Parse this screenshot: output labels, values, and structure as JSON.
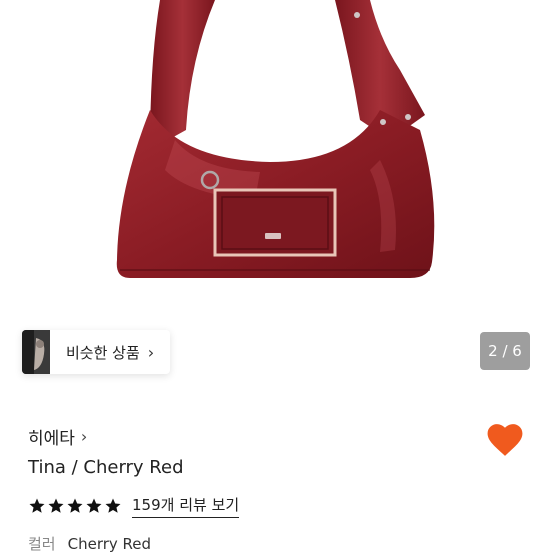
{
  "gallery": {
    "image_alt": "Tina / Cherry Red bag",
    "counter": "2 / 6"
  },
  "similar": {
    "label": "비슷한 상품",
    "chevron_icon": "chevron-right-icon"
  },
  "product": {
    "brand": "히에타",
    "brand_chevron_icon": "chevron-right-icon",
    "name": "Tina / Cherry Red",
    "rating_stars": 5,
    "review_link": "159개 리뷰 보기",
    "option_label": "컬러",
    "option_value": "Cherry Red"
  },
  "wishlist": {
    "icon": "heart-icon",
    "active": true
  },
  "colors": {
    "bag": "#8a1c24",
    "heart": "#f05a1e",
    "counter_bg": "#9e9e9e",
    "star": "#111111"
  }
}
